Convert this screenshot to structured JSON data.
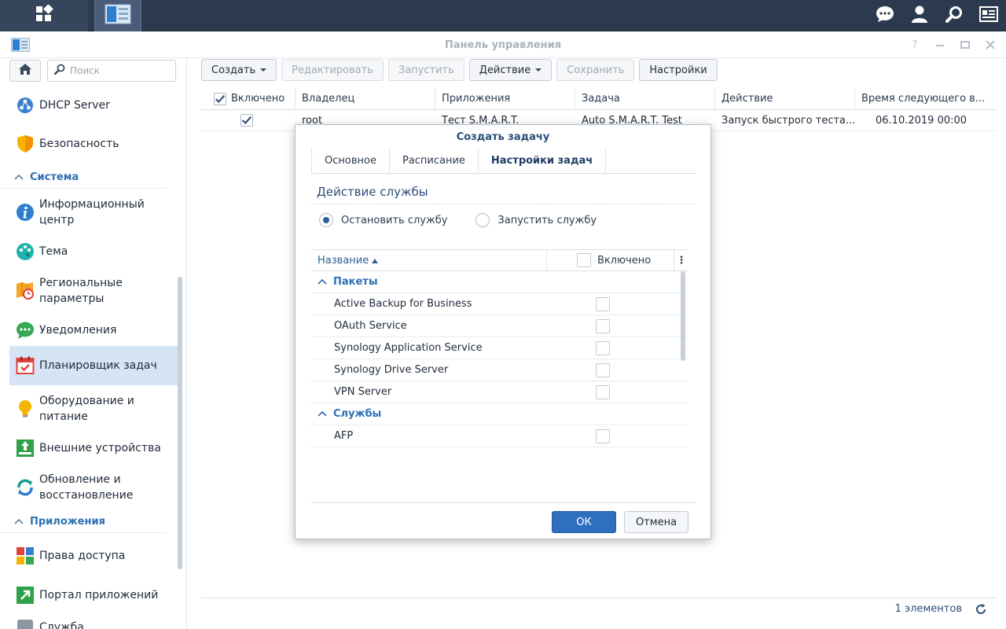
{
  "window": {
    "title": "Панель управления"
  },
  "taskbar": {
    "icons": [
      "grid-icon",
      "control-panel-icon",
      "chat-icon",
      "user-icon",
      "search-icon",
      "widgets-icon"
    ]
  },
  "sidebar": {
    "search_placeholder": "Поиск",
    "items": [
      {
        "label": "DHCP Server",
        "icon": "dhcp-icon"
      },
      {
        "label": "Безопасность",
        "icon": "shield-icon"
      },
      {
        "group": "Система"
      },
      {
        "label": "Информационный центр",
        "icon": "info-icon"
      },
      {
        "label": "Тема",
        "icon": "palette-icon"
      },
      {
        "label": "Региональные параметры",
        "icon": "regional-icon"
      },
      {
        "label": "Уведомления",
        "icon": "notifications-icon"
      },
      {
        "label": "Планировщик задач",
        "icon": "calendar-icon",
        "active": true
      },
      {
        "label": "Оборудование и питание",
        "icon": "bulb-icon"
      },
      {
        "label": "Внешние устройства",
        "icon": "external-device-icon"
      },
      {
        "label": "Обновление и восстановление",
        "icon": "update-icon"
      },
      {
        "group": "Приложения"
      },
      {
        "label": "Права доступа",
        "icon": "privileges-icon"
      },
      {
        "label": "Портал приложений",
        "icon": "portal-icon"
      },
      {
        "label": "Служба",
        "icon": "service-icon"
      }
    ]
  },
  "toolbar": {
    "create": "Создать",
    "edit": "Редактировать",
    "run": "Запустить",
    "action": "Действие",
    "save": "Сохранить",
    "settings": "Настройки"
  },
  "grid": {
    "columns": [
      "Включено",
      "Владелец",
      "Приложения",
      "Задача",
      "Действие",
      "Время следующего в..."
    ],
    "rows": [
      {
        "enabled": true,
        "owner": "root",
        "app": "Тест S.M.A.R.T.",
        "task": "Auto S.M.A.R.T. Test",
        "action": "Запуск быстрого теста...",
        "next_run": "06.10.2019 00:00"
      }
    ],
    "footer_count": "1 элементов"
  },
  "dialog": {
    "title": "Создать задачу",
    "tabs": [
      "Основное",
      "Расписание",
      "Настройки задач"
    ],
    "active_tab": "Настройки задач",
    "section_title": "Действие службы",
    "radio_stop": "Остановить службу",
    "radio_start": "Запустить службу",
    "selected_radio": "stop",
    "table": {
      "col_name": "Название",
      "col_enabled": "Включено",
      "groups": [
        {
          "name": "Пакеты",
          "items": [
            "Active Backup for Business",
            "OAuth Service",
            "Synology Application Service",
            "Synology Drive Server",
            "VPN Server"
          ]
        },
        {
          "name": "Службы",
          "items": [
            "AFP"
          ]
        }
      ]
    },
    "ok": "ОК",
    "cancel": "Отмена"
  },
  "colors": {
    "taskbar": "#2c3a4f",
    "accent": "#2e6fbf",
    "active_item": "#d6e5f5"
  }
}
